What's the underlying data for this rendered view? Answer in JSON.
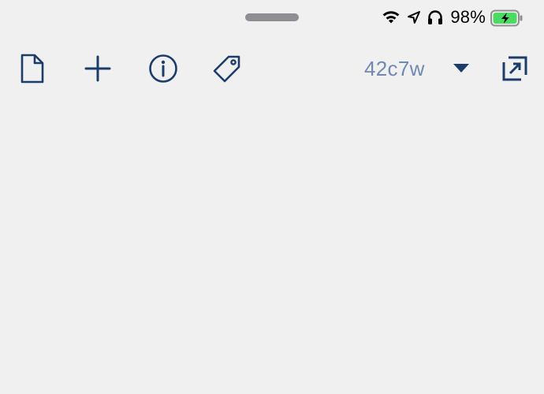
{
  "status_bar": {
    "battery_percent": "98%",
    "icons": [
      "wifi-icon",
      "location-arrow-icon",
      "headphones-icon",
      "battery-charging-icon"
    ],
    "battery_fill_color": "#4cd964"
  },
  "toolbar": {
    "buttons": [
      "new-document-icon",
      "add-icon",
      "info-icon",
      "tag-icon",
      "expand-icon"
    ],
    "version_label": "42c7w",
    "icon_color": "#1c3d6c",
    "version_color": "#7089b3"
  }
}
